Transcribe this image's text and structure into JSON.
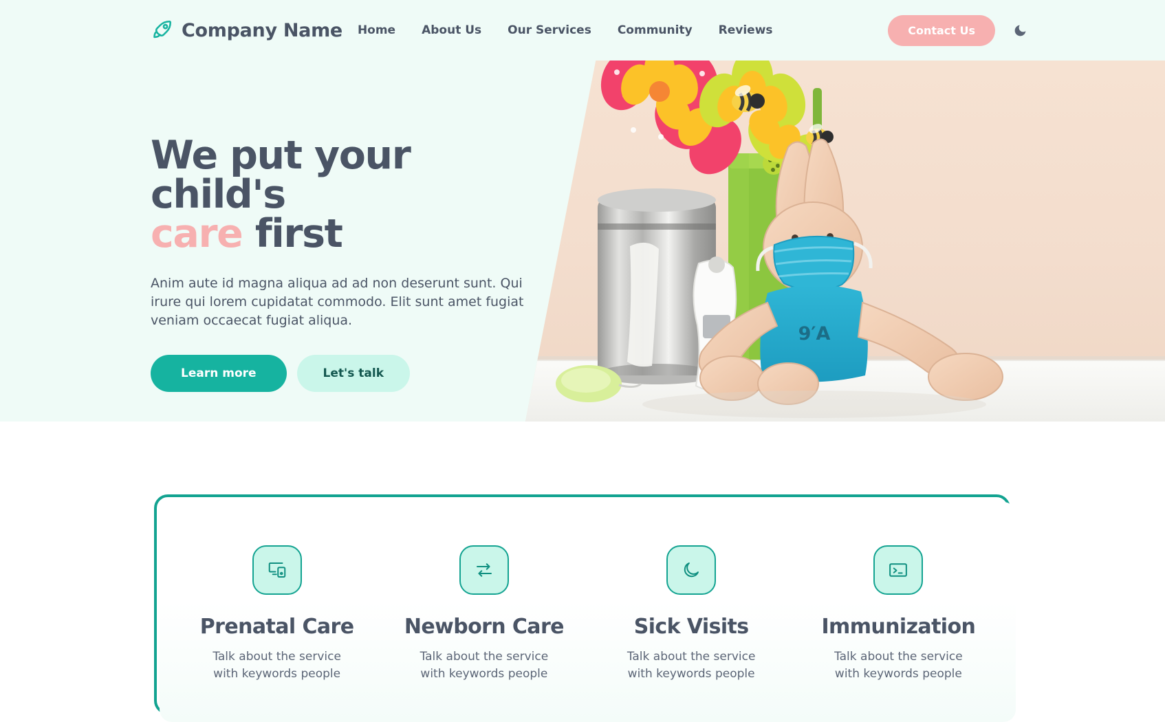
{
  "theme": {
    "teal": "#16b3a0",
    "teal_dark": "#13a391",
    "teal_pale": "#caf6ea",
    "mint_bg": "#effbf7",
    "pink": "#f7b0b0",
    "slate": "#4a5465"
  },
  "navbar": {
    "logo_icon": "rocket-icon",
    "brand": "Company Name",
    "links": [
      {
        "label": "Home"
      },
      {
        "label": "About Us"
      },
      {
        "label": "Our Services"
      },
      {
        "label": "Community"
      },
      {
        "label": "Reviews"
      }
    ],
    "contact_button": "Contact Us",
    "theme_toggle_icon": "moon-icon"
  },
  "hero": {
    "title_line1": "We put your child's",
    "title_accent": "care",
    "title_tail": " first",
    "paragraph": "Anim aute id magna aliqua ad ad non deserunt sunt. Qui irure qui lorem cupidatat commodo. Elit sunt amet fugiat veniam occaecat fugiat aliqua.",
    "primary_button": "Learn more",
    "secondary_button": "Let's talk",
    "image_alt": "Crocheted bunny toy wearing a blue face mask beside a digital thermometer, metal canister and colorful pinwheel flowers"
  },
  "features": [
    {
      "icon": "devices-icon",
      "title": "Prenatal Care",
      "description": "Talk about the service with keywords people"
    },
    {
      "icon": "swap-arrows-icon",
      "title": "Newborn Care",
      "description": "Talk about the service with keywords people"
    },
    {
      "icon": "moon-icon",
      "title": "Sick Visits",
      "description": "Talk about the service with keywords people"
    },
    {
      "icon": "terminal-icon",
      "title": "Immunization",
      "description": "Talk about the service with keywords people"
    }
  ]
}
